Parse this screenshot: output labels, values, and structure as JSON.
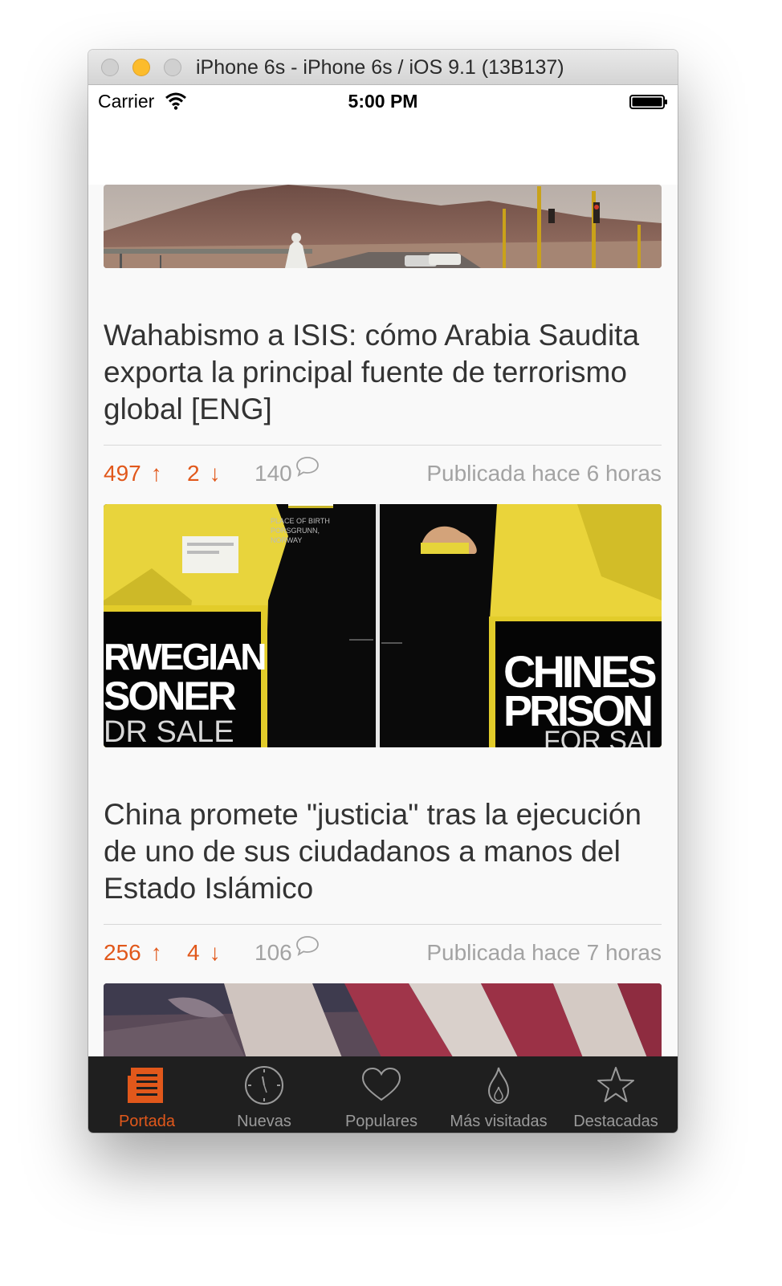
{
  "window": {
    "title": "iPhone 6s - iPhone 6s / iOS 9.1 (13B137)"
  },
  "status_bar": {
    "carrier": "Carrier",
    "time": "5:00 PM"
  },
  "colors": {
    "accent": "#e1581b",
    "muted": "#a3a3a3",
    "tabbar": "#1f1f1f",
    "title_text": "#333333"
  },
  "articles": [
    {
      "title": "Wahabismo a ISIS: cómo Arabia Saudita exporta la principal fuente de terrorismo global [ENG]",
      "votes_up": "497",
      "votes_down": "2",
      "comments": "140",
      "published": "Publicada hace 6 horas"
    },
    {
      "title": "China promete \"justicia\" tras la ejecución de uno de sus ciudadanos a manos del Estado Islámico",
      "image_text": {
        "left_small": [
          "PLACE OF BIRTH",
          "PORSGRUNN,",
          "NORWAY"
        ],
        "left_big_1": "RWEGIAN",
        "left_big_2": "SONER",
        "left_big_3": "DR SALE",
        "right_big_1": "CHINES",
        "right_big_2": "PRISON",
        "right_big_3": "FOR SAL"
      },
      "votes_up": "256",
      "votes_down": "4",
      "comments": "106",
      "published": "Publicada hace 7 horas"
    }
  ],
  "tab_bar": {
    "tabs": [
      {
        "label": "Portada",
        "icon": "newspaper-icon",
        "active": true
      },
      {
        "label": "Nuevas",
        "icon": "clock-icon",
        "active": false
      },
      {
        "label": "Populares",
        "icon": "heart-icon",
        "active": false
      },
      {
        "label": "Más visitadas",
        "icon": "flame-icon",
        "active": false
      },
      {
        "label": "Destacadas",
        "icon": "star-icon",
        "active": false
      }
    ]
  }
}
